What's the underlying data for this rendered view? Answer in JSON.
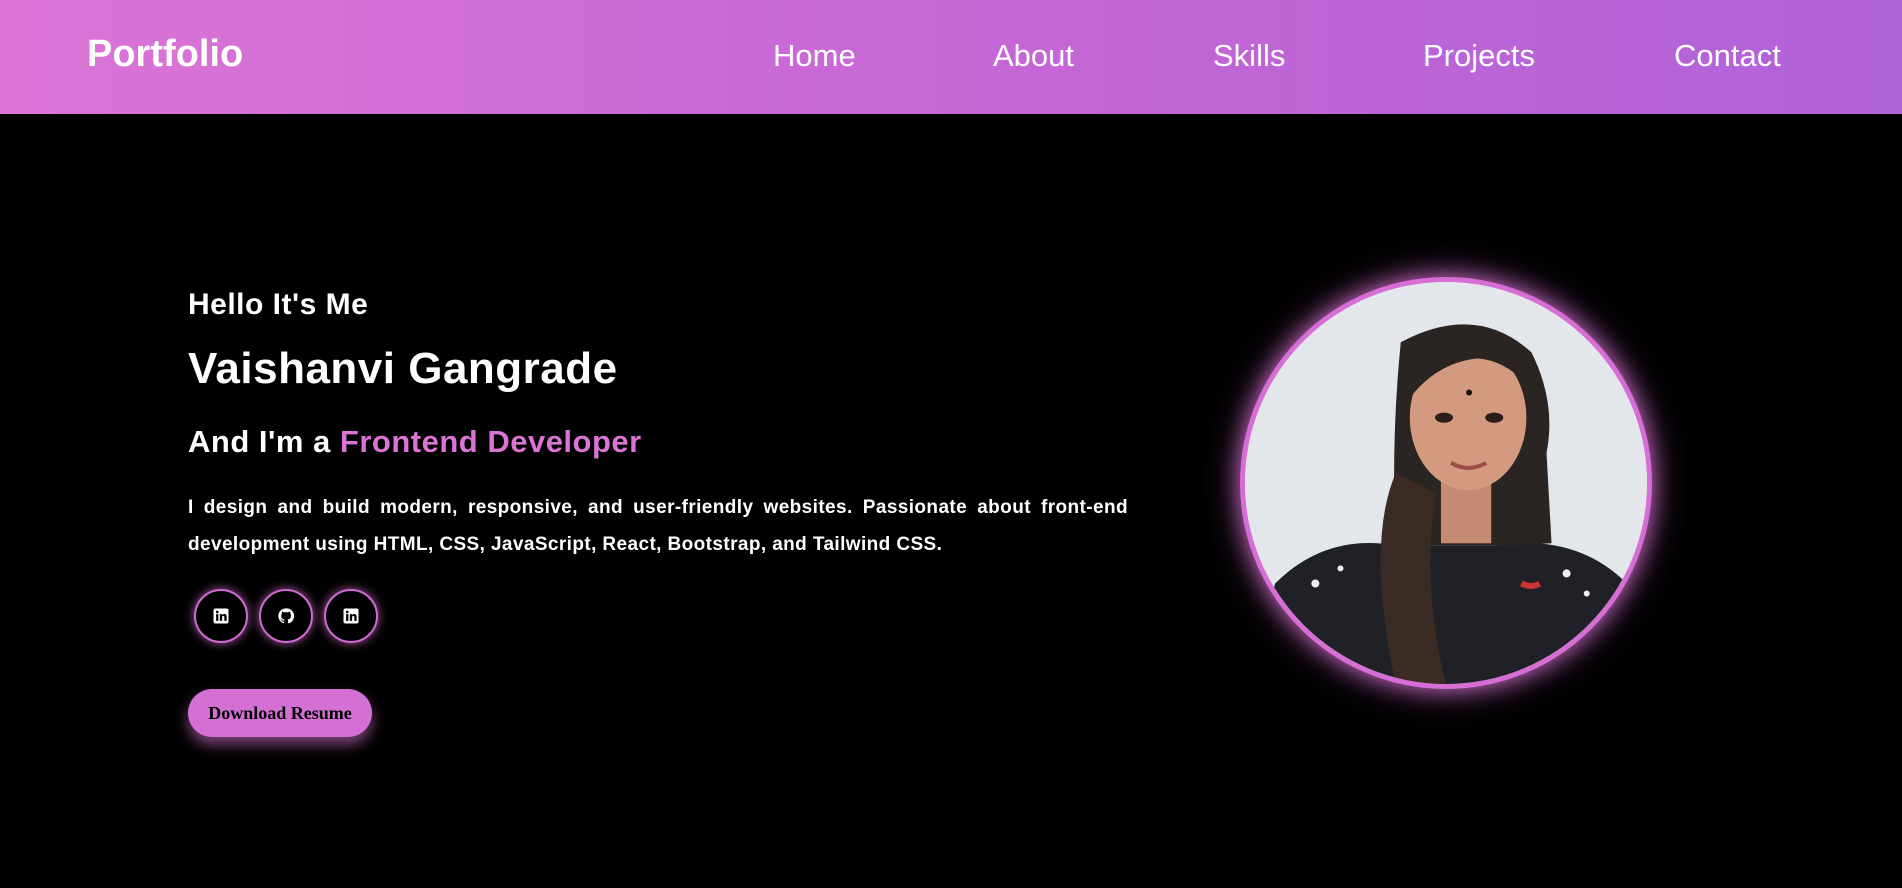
{
  "nav": {
    "brand": "Portfolio",
    "links": [
      "Home",
      "About",
      "Skills",
      "Projects",
      "Contact"
    ]
  },
  "hero": {
    "greeting": "Hello It's Me",
    "name": "Vaishanvi Gangrade",
    "role_prefix": "And I'm a",
    "role": "Frontend Developer",
    "description": "I design and build modern, responsive, and user-friendly websites. Passionate about front-end development using HTML, CSS, JavaScript, React, Bootstrap, and Tailwind CSS.",
    "socials": [
      {
        "icon": "linkedin-icon"
      },
      {
        "icon": "github-icon"
      },
      {
        "icon": "linkedin-icon"
      }
    ],
    "resume_button": "Download Resume"
  },
  "colors": {
    "accent": "#dc74d6",
    "nav_gradient_start": "#dc74d6",
    "nav_gradient_end": "#b062d8",
    "background": "#000000"
  },
  "profile_image": {
    "icon": "profile-photo"
  }
}
